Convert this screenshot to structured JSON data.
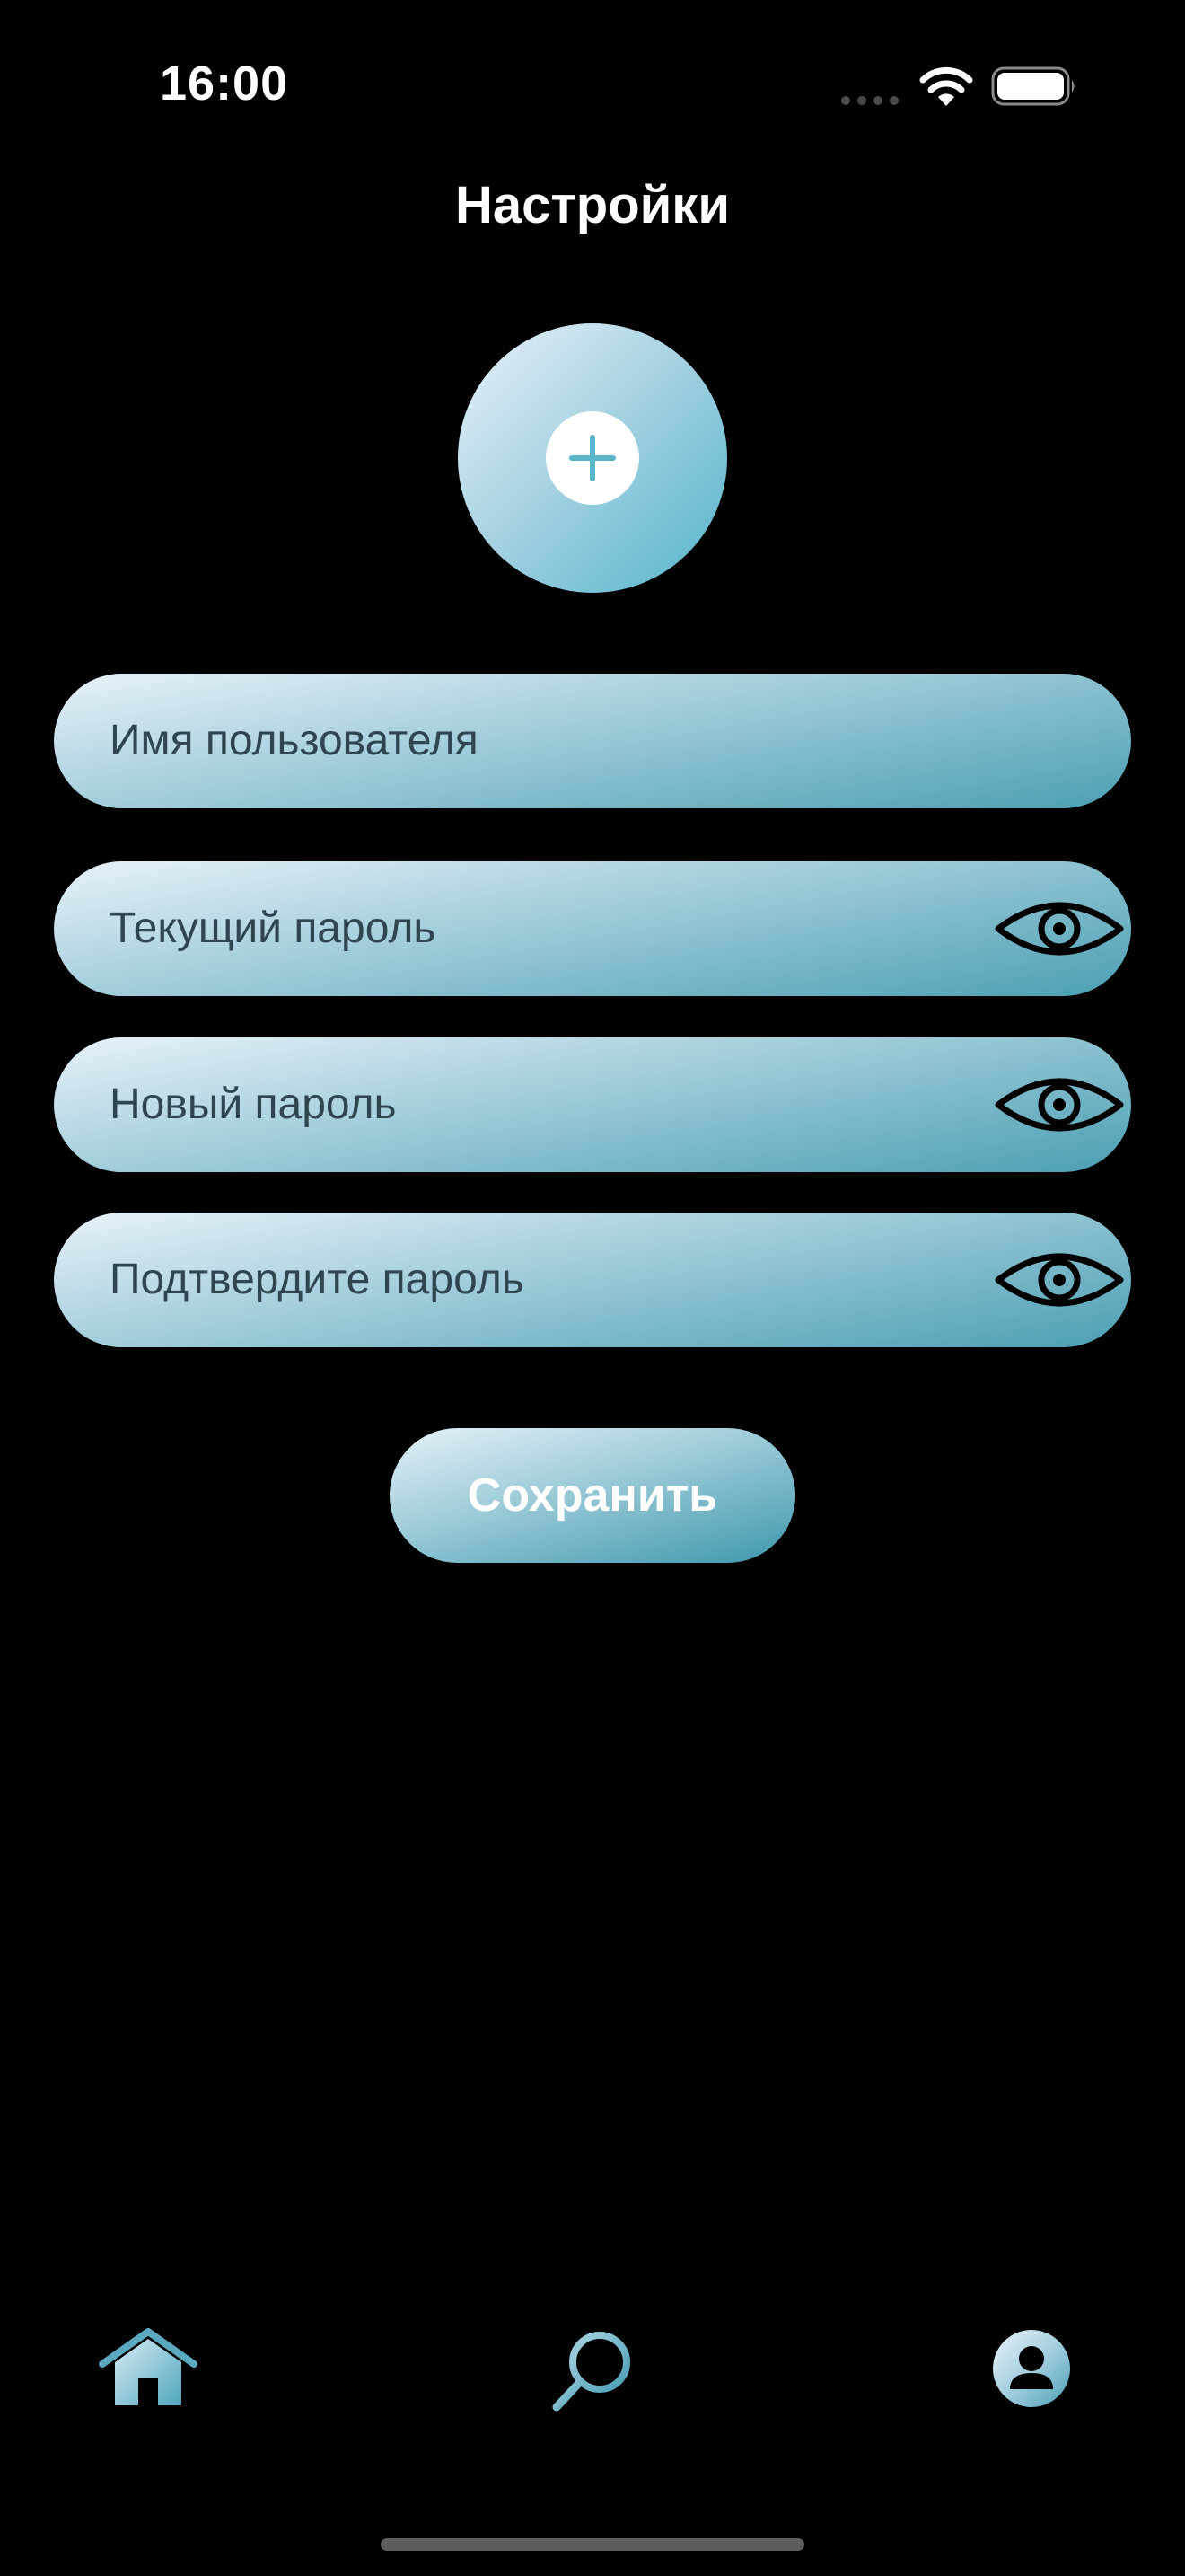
{
  "status_bar": {
    "time": "16:00"
  },
  "header": {
    "title": "Настройки"
  },
  "avatar": {
    "icon": "plus-icon"
  },
  "form": {
    "fields": [
      {
        "placeholder": "Имя пользователя",
        "has_eye": false
      },
      {
        "placeholder": "Текущий пароль",
        "has_eye": true
      },
      {
        "placeholder": "Новый пароль",
        "has_eye": true
      },
      {
        "placeholder": "Подтвердите пароль",
        "has_eye": true
      }
    ],
    "save_label": "Сохранить"
  },
  "tab_bar": {
    "items": [
      {
        "icon": "home-icon"
      },
      {
        "icon": "search-icon"
      },
      {
        "icon": "profile-icon"
      }
    ]
  },
  "colors": {
    "background": "#000000",
    "accent_light": "#eaf3fa",
    "accent": "#53b4cc",
    "accent_dark": "#3e98ad",
    "field_text": "#2f4550"
  }
}
